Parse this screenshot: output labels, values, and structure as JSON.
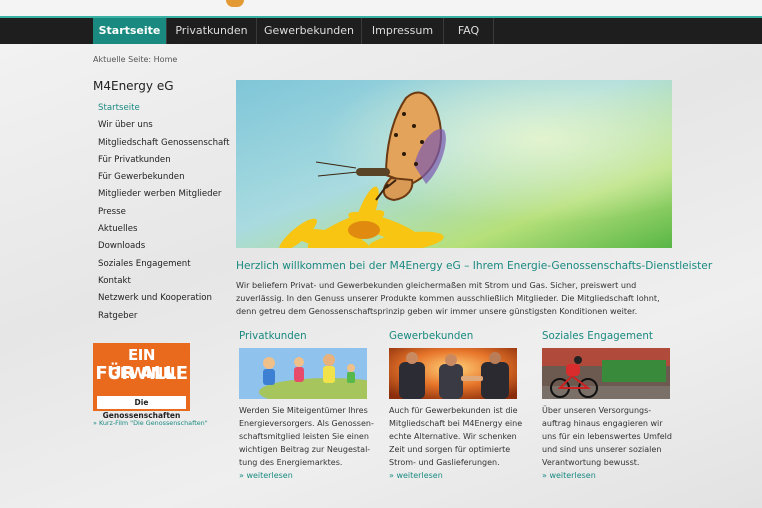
{
  "nav": {
    "items": [
      {
        "label": "Startseite",
        "active": true
      },
      {
        "label": "Privatkunden",
        "active": false
      },
      {
        "label": "Gewerbekunden",
        "active": false
      },
      {
        "label": "Impressum",
        "active": false
      },
      {
        "label": "FAQ",
        "active": false
      }
    ]
  },
  "breadcrumb": "Aktuelle Seite: Home",
  "sidebar": {
    "title": "M4Energy eG",
    "items": [
      {
        "label": "Startseite",
        "active": true
      },
      {
        "label": "Wir über uns"
      },
      {
        "label": "Mitgliedschaft Genossenschaft"
      },
      {
        "label": "Für Privatkunden"
      },
      {
        "label": "Für Gewerbekunden"
      },
      {
        "label": "Mitglieder werben Mitglieder"
      },
      {
        "label": "Presse"
      },
      {
        "label": "Aktuelles"
      },
      {
        "label": "Downloads"
      },
      {
        "label": "Soziales Engagement"
      },
      {
        "label": "Kontakt"
      },
      {
        "label": "Netzwerk und Kooperation"
      },
      {
        "label": "Ratgeber"
      }
    ],
    "badge": {
      "line1": "EIN GEWINN",
      "line2": "FÜR ALLE",
      "sub": "Die Genossenschaften"
    },
    "film_link": "» Kurz-Film \"Die Genossenschaften\""
  },
  "main": {
    "welcome": "Herzlich willkommen bei der M4Energy eG – Ihrem Energie-Genossenschafts-Dienstleister",
    "intro": "Wir beliefern Privat- und Gewerbekunden gleichermaßen mit Strom und Gas. Sicher, preiswert und zuverlässig. In den Genuss unserer Produkte kommen ausschließlich Mitglieder. Die Mitgliedschaft lohnt, denn getreu dem Genossenschaftsprinzip geben wir immer unsere günstigsten Konditionen weiter.",
    "columns": [
      {
        "title": "Privatkunden",
        "text": "Werden Sie Miteigentümer Ihres Energieversorgers. Als Genossen-schaftsmitglied leisten Sie einen wichtigen Beitrag zur Neugestal-tung des Energiemarktes.",
        "more": "» weiterlesen"
      },
      {
        "title": "Gewerbekunden",
        "text": "Auch für Gewerbekunden ist die Mitgliedschaft bei M4Energy eine echte Alternative. Wir schenken Zeit und sorgen für optimierte Strom- und Gaslieferungen.",
        "more": "» weiterlesen"
      },
      {
        "title": "Soziales Engagement",
        "text": "Über unseren Versorgungs-auftrag hinaus engagieren wir uns für ein lebenswertes Umfeld und sind uns unserer sozialen Verantwortung bewusst.",
        "more": "» weiterlesen"
      }
    ]
  },
  "colors": {
    "accent": "#1a8a80",
    "nav_bg": "#1e1e1e",
    "badge": "#ea6a1d"
  }
}
